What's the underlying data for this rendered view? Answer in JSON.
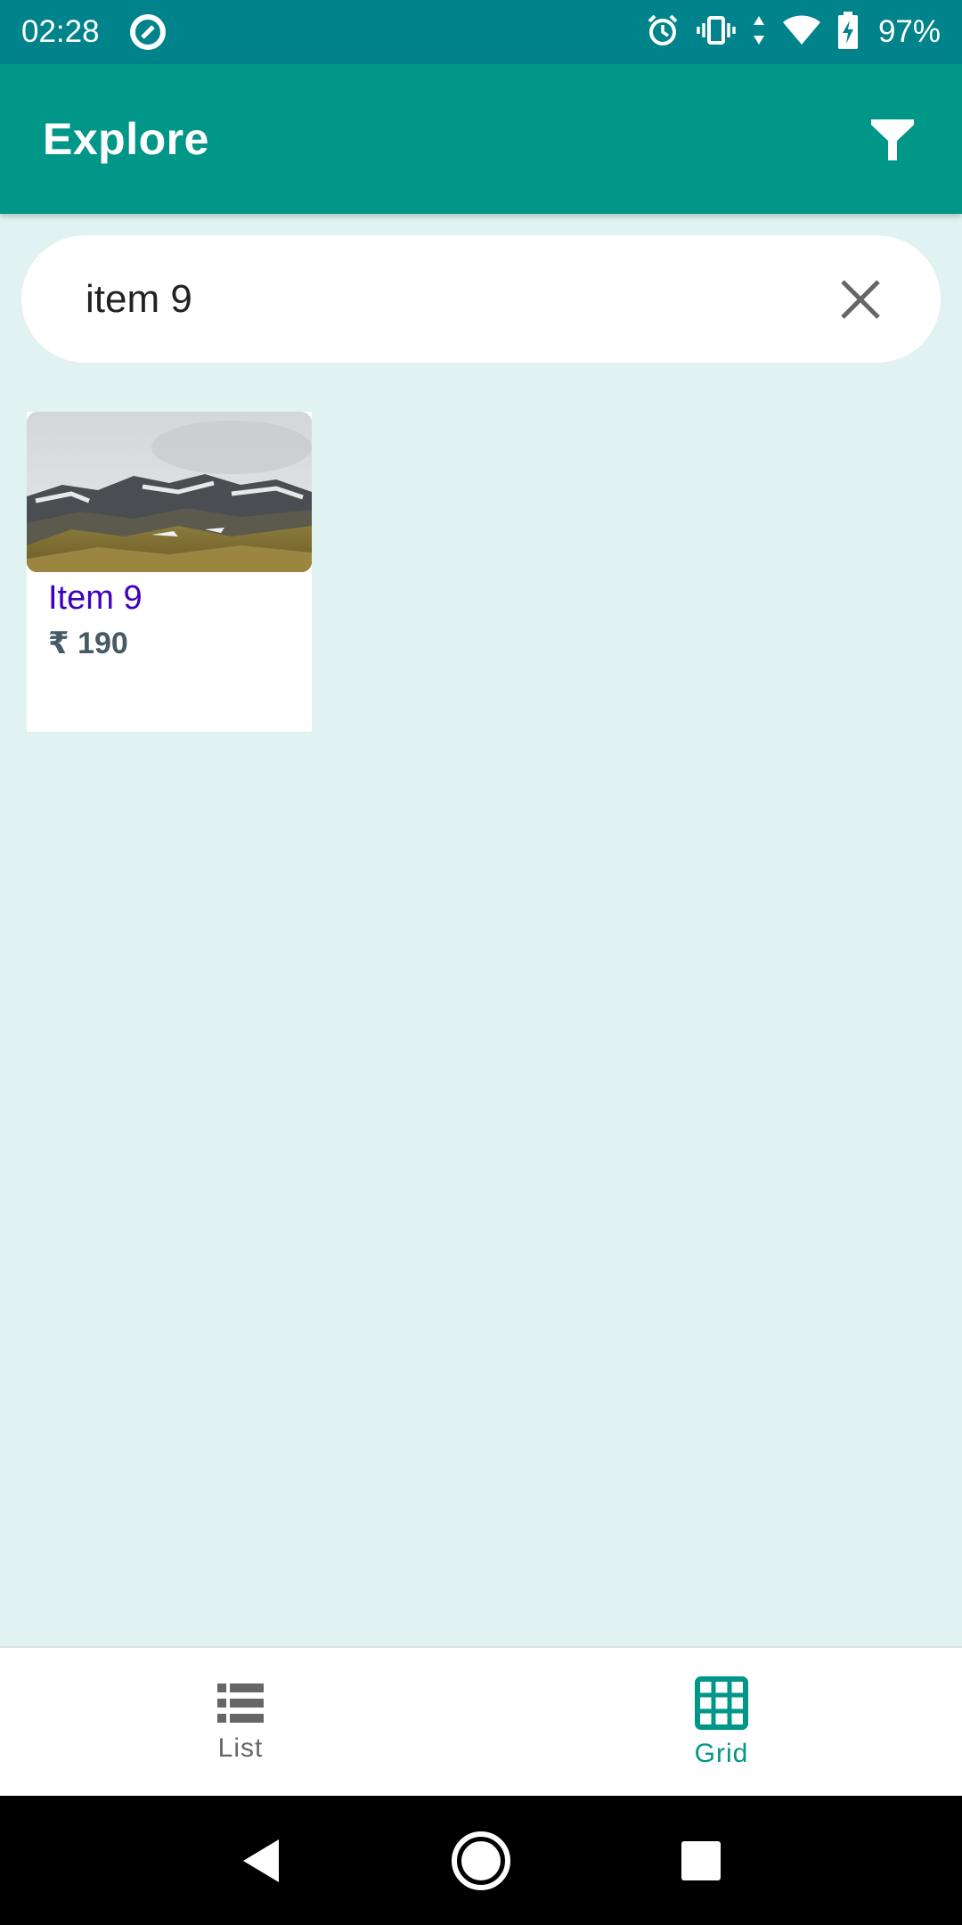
{
  "status_bar": {
    "time": "02:28",
    "battery": "97%",
    "icons": [
      "app-notification-icon",
      "alarm-icon",
      "vibrate-icon",
      "data-arrows-icon",
      "wifi-icon",
      "battery-charging-icon"
    ]
  },
  "app_bar": {
    "title": "Explore",
    "filter_icon": "filter-icon"
  },
  "search": {
    "value": "item 9",
    "clear_icon": "close-icon"
  },
  "results": [
    {
      "title": "Item 9",
      "price": "₹ 190",
      "image": "mountain-landscape"
    }
  ],
  "bottom_nav": {
    "items": [
      {
        "label": "List",
        "icon": "list-icon",
        "active": false
      },
      {
        "label": "Grid",
        "icon": "grid-icon",
        "active": true
      }
    ]
  },
  "colors": {
    "primary": "#009688",
    "status_bar": "#00838a",
    "background": "#e0f2f1",
    "item_title": "#3f00c0",
    "price": "#455a64"
  }
}
